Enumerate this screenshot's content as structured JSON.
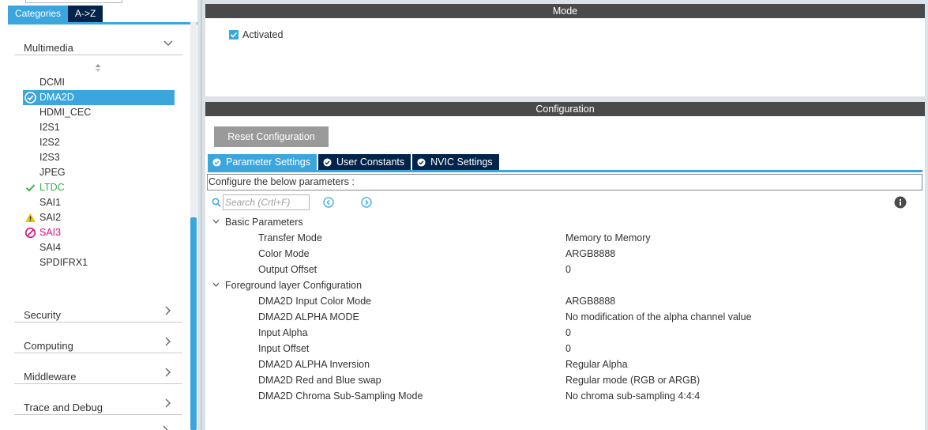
{
  "categories": {
    "tabs": [
      {
        "label": "Categories",
        "active": true
      },
      {
        "label": "A->Z",
        "active": false
      }
    ],
    "open_group": {
      "label": "Multimedia",
      "items": [
        {
          "label": "DCMI",
          "status": "none"
        },
        {
          "label": "DMA2D",
          "status": "enabled",
          "selected": true
        },
        {
          "label": "HDMI_CEC",
          "status": "none"
        },
        {
          "label": "I2S1",
          "status": "none"
        },
        {
          "label": "I2S2",
          "status": "none"
        },
        {
          "label": "I2S3",
          "status": "none"
        },
        {
          "label": "JPEG",
          "status": "none"
        },
        {
          "label": "LTDC",
          "status": "ok"
        },
        {
          "label": "SAI1",
          "status": "none"
        },
        {
          "label": "SAI2",
          "status": "warning"
        },
        {
          "label": "SAI3",
          "status": "error"
        },
        {
          "label": "SAI4",
          "status": "none"
        },
        {
          "label": "SPDIFRX1",
          "status": "none"
        }
      ]
    },
    "groups": [
      {
        "label": "Security"
      },
      {
        "label": "Computing"
      },
      {
        "label": "Middleware"
      },
      {
        "label": "Trace and Debug"
      }
    ]
  },
  "mode": {
    "title": "Mode",
    "activated_label": "Activated",
    "activated": true
  },
  "configuration": {
    "title": "Configuration",
    "reset_label": "Reset Configuration",
    "tabs": [
      {
        "label": "Parameter Settings",
        "active": true
      },
      {
        "label": "User Constants",
        "active": false
      },
      {
        "label": "NVIC Settings",
        "active": false
      }
    ],
    "hint": "Configure the below parameters :",
    "search_placeholder": "Search (Crtl+F)",
    "groups": [
      {
        "label": "Basic Parameters",
        "params": [
          {
            "name": "Transfer Mode",
            "value": "Memory to Memory"
          },
          {
            "name": "Color Mode",
            "value": "ARGB8888"
          },
          {
            "name": "Output Offset",
            "value": "0"
          }
        ]
      },
      {
        "label": "Foreground layer Configuration",
        "params": [
          {
            "name": "DMA2D Input Color Mode",
            "value": "ARGB8888"
          },
          {
            "name": "DMA2D ALPHA MODE",
            "value": "No modification of the alpha channel value"
          },
          {
            "name": "Input Alpha",
            "value": "0"
          },
          {
            "name": "Input Offset",
            "value": "0"
          },
          {
            "name": "DMA2D ALPHA Inversion",
            "value": "Regular Alpha"
          },
          {
            "name": "DMA2D Red and Blue swap",
            "value": "Regular mode (RGB or ARGB)"
          },
          {
            "name": "DMA2D Chroma Sub-Sampling Mode",
            "value": "No chroma sub-sampling 4:4:4"
          }
        ]
      }
    ]
  },
  "colors": {
    "accent": "#3ba6dd",
    "dark_tab": "#03234b",
    "ok_green": "#35b24a",
    "warning_yellow": "#f2c200",
    "error_magenta": "#d4147a",
    "panel_bar": "#4a4a4a"
  }
}
